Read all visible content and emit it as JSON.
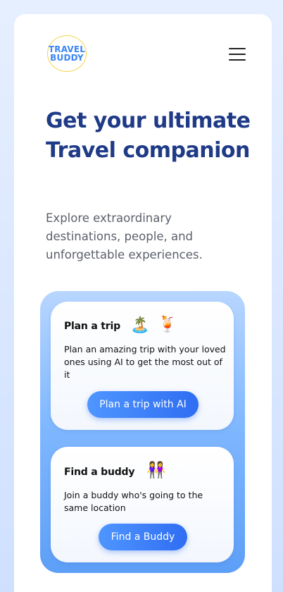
{
  "logo": {
    "line1": "TRAVEL",
    "line2": "BUDDY"
  },
  "hero": {
    "title": "Get your ultimate Travel companion",
    "subtitle": "Explore extraordinary destinations, people, and unforgettable experiences."
  },
  "cards": [
    {
      "title": "Plan a trip",
      "icons": [
        "island-icon",
        "cocktail-icon"
      ],
      "icon_glyphs": [
        "🏝️",
        "🍹"
      ],
      "description": "Plan an amazing trip with your loved ones using AI to get the most out of it",
      "button_label": "Plan a trip with AI"
    },
    {
      "title": "Find a buddy",
      "icons": [
        "two-women-icon"
      ],
      "icon_glyphs": [
        "👭"
      ],
      "description": "Join a buddy who's going to the same location",
      "button_label": "Find a Buddy"
    }
  ],
  "colors": {
    "accent": "#2f6df2",
    "heading": "#1f3a86",
    "logo_text": "#3a86f3",
    "logo_ring": "#f2d64a"
  }
}
